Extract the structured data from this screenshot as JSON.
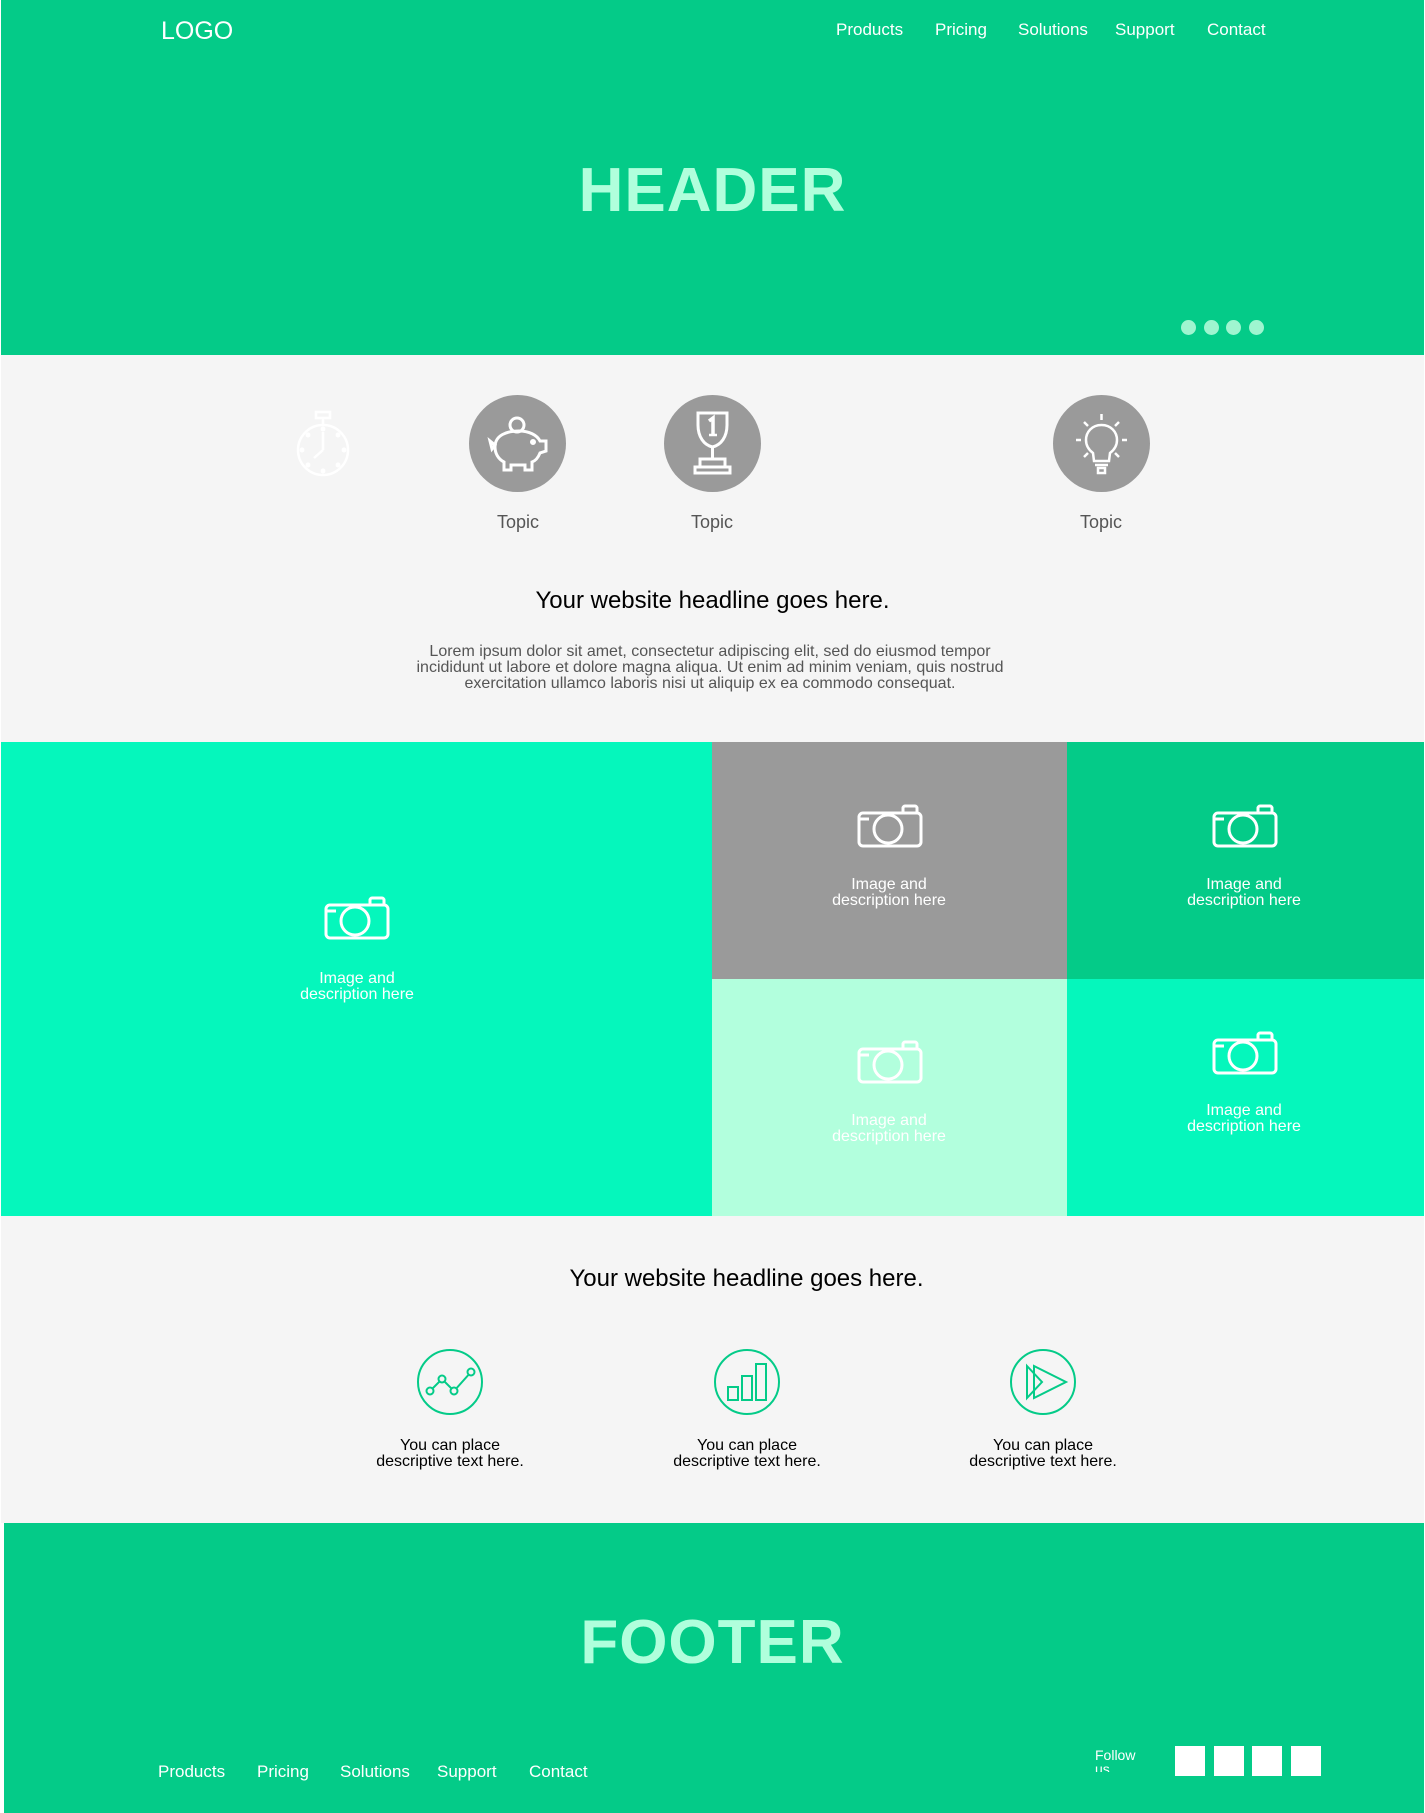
{
  "header": {
    "logo": "LOGO",
    "nav": [
      "Products",
      "Pricing",
      "Solutions",
      "Support",
      "Contact"
    ],
    "title": "HEADER",
    "carousel_dots": 4
  },
  "topics": {
    "items": [
      {
        "icon": "stopwatch-icon",
        "label": ""
      },
      {
        "icon": "piggy-bank-icon",
        "label": "Topic"
      },
      {
        "icon": "trophy-icon",
        "label": "Topic"
      },
      {
        "icon": "lightbulb-icon",
        "label": "Topic"
      }
    ],
    "headline": "Your website headline goes here.",
    "body_lines": [
      "Lorem ipsum dolor sit amet, consectetur adipiscing elit, sed do eiusmod tempor",
      "incididunt ut labore et dolore magna aliqua. Ut enim ad minim veniam, quis nostrud",
      "exercitation ullamco laboris nisi ut aliquip ex ea commodo consequat."
    ]
  },
  "gallery": {
    "tiles": [
      {
        "icon": "camera-icon",
        "caption": [
          "Image and",
          "description here"
        ],
        "color": "#05f7bc"
      },
      {
        "icon": "camera-icon",
        "caption": [
          "Image and",
          "description here"
        ],
        "color": "#9a9a9a"
      },
      {
        "icon": "camera-icon",
        "caption": [
          "Image and",
          "description here"
        ],
        "color": "#04cb88"
      },
      {
        "icon": "camera-icon",
        "caption": [
          "Image and",
          "description here"
        ],
        "color": "#b2ffdd"
      },
      {
        "icon": "camera-icon",
        "caption": [
          "Image and",
          "description here"
        ],
        "color": "#05f7bc"
      }
    ]
  },
  "features": {
    "headline": "Your website headline goes here.",
    "items": [
      {
        "icon": "line-chart-icon",
        "text": [
          "You can place",
          "descriptive text here."
        ]
      },
      {
        "icon": "bar-chart-icon",
        "text": [
          "You can place",
          "descriptive text here."
        ]
      },
      {
        "icon": "play-forward-icon",
        "text": [
          "You can place",
          "descriptive text here."
        ]
      }
    ]
  },
  "footer": {
    "title": "FOOTER",
    "nav": [
      "Products",
      "Pricing",
      "Solutions",
      "Support",
      "Contact"
    ],
    "follow": "Follow us",
    "social_count": 4
  },
  "colors": {
    "brand_green": "#04cb88",
    "bright_mint": "#05f7bc",
    "pale_mint": "#b2ffdd",
    "gray": "#9a9a9a",
    "background": "#f5f5f5"
  }
}
